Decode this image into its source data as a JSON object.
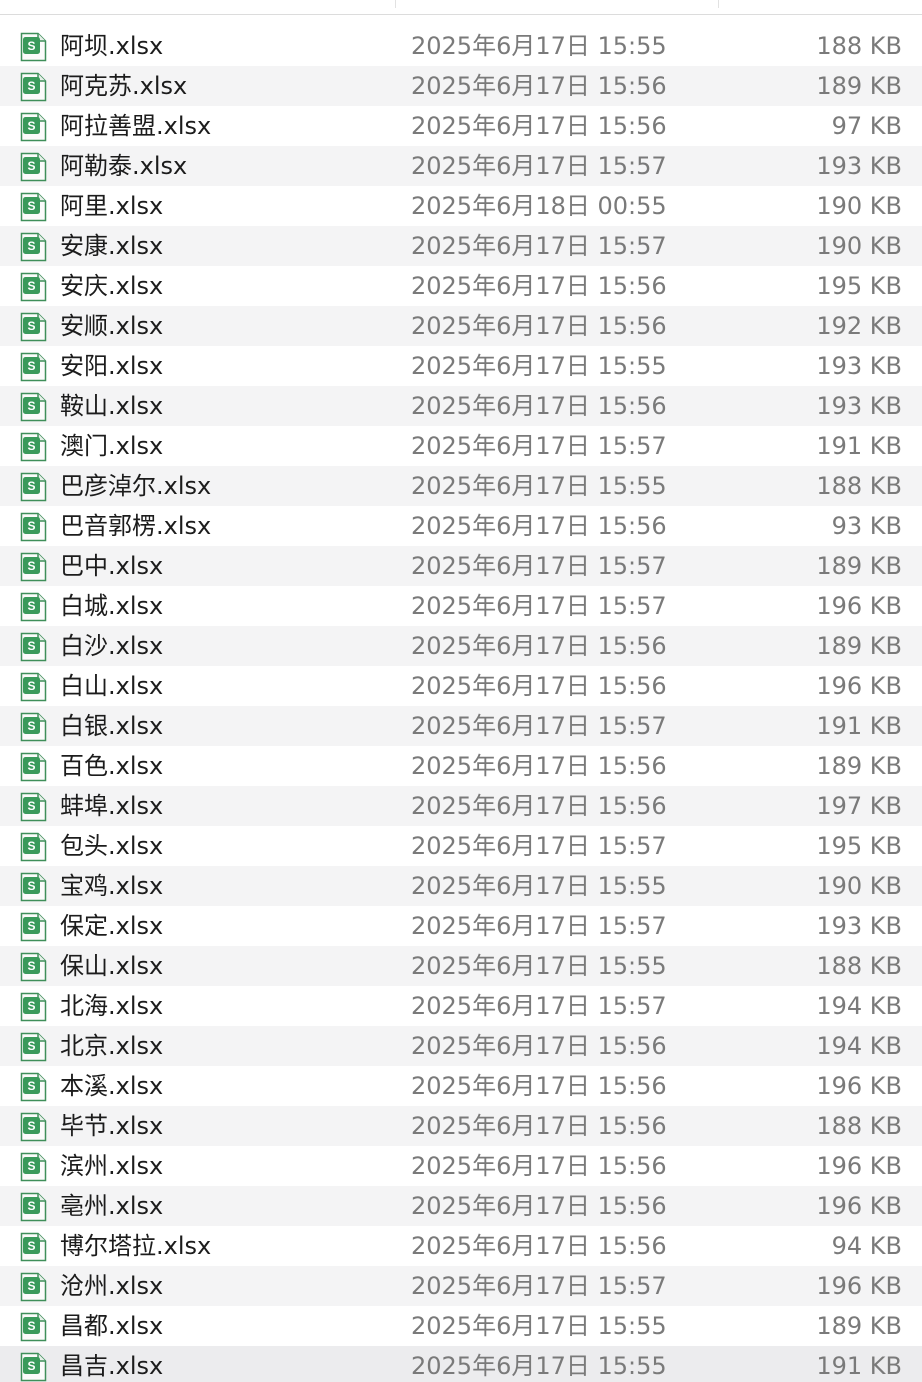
{
  "icon": "spreadsheet-file-icon",
  "icon_badge": "S",
  "colors": {
    "icon_green": "#3a9a5b",
    "icon_border": "#3f8f5a",
    "stripe": "#f4f4f5",
    "name_text": "#1c1c1c",
    "meta_text": "#7a7a7a"
  },
  "files": [
    {
      "name": "阿坝.xlsx",
      "date": "2025年6月17日 15:55",
      "size": "188 KB"
    },
    {
      "name": "阿克苏.xlsx",
      "date": "2025年6月17日 15:56",
      "size": "189 KB"
    },
    {
      "name": "阿拉善盟.xlsx",
      "date": "2025年6月17日 15:56",
      "size": "97 KB"
    },
    {
      "name": "阿勒泰.xlsx",
      "date": "2025年6月17日 15:57",
      "size": "193 KB"
    },
    {
      "name": "阿里.xlsx",
      "date": "2025年6月18日 00:55",
      "size": "190 KB"
    },
    {
      "name": "安康.xlsx",
      "date": "2025年6月17日 15:57",
      "size": "190 KB"
    },
    {
      "name": "安庆.xlsx",
      "date": "2025年6月17日 15:56",
      "size": "195 KB"
    },
    {
      "name": "安顺.xlsx",
      "date": "2025年6月17日 15:56",
      "size": "192 KB"
    },
    {
      "name": "安阳.xlsx",
      "date": "2025年6月17日 15:55",
      "size": "193 KB"
    },
    {
      "name": "鞍山.xlsx",
      "date": "2025年6月17日 15:56",
      "size": "193 KB"
    },
    {
      "name": "澳门.xlsx",
      "date": "2025年6月17日 15:57",
      "size": "191 KB"
    },
    {
      "name": "巴彦淖尔.xlsx",
      "date": "2025年6月17日 15:55",
      "size": "188 KB"
    },
    {
      "name": "巴音郭楞.xlsx",
      "date": "2025年6月17日 15:56",
      "size": "93 KB"
    },
    {
      "name": "巴中.xlsx",
      "date": "2025年6月17日 15:57",
      "size": "189 KB"
    },
    {
      "name": "白城.xlsx",
      "date": "2025年6月17日 15:57",
      "size": "196 KB"
    },
    {
      "name": "白沙.xlsx",
      "date": "2025年6月17日 15:56",
      "size": "189 KB"
    },
    {
      "name": "白山.xlsx",
      "date": "2025年6月17日 15:56",
      "size": "196 KB"
    },
    {
      "name": "白银.xlsx",
      "date": "2025年6月17日 15:57",
      "size": "191 KB"
    },
    {
      "name": "百色.xlsx",
      "date": "2025年6月17日 15:56",
      "size": "189 KB"
    },
    {
      "name": "蚌埠.xlsx",
      "date": "2025年6月17日 15:56",
      "size": "197 KB"
    },
    {
      "name": "包头.xlsx",
      "date": "2025年6月17日 15:57",
      "size": "195 KB"
    },
    {
      "name": "宝鸡.xlsx",
      "date": "2025年6月17日 15:55",
      "size": "190 KB"
    },
    {
      "name": "保定.xlsx",
      "date": "2025年6月17日 15:57",
      "size": "193 KB"
    },
    {
      "name": "保山.xlsx",
      "date": "2025年6月17日 15:55",
      "size": "188 KB"
    },
    {
      "name": "北海.xlsx",
      "date": "2025年6月17日 15:57",
      "size": "194 KB"
    },
    {
      "name": "北京.xlsx",
      "date": "2025年6月17日 15:56",
      "size": "194 KB"
    },
    {
      "name": "本溪.xlsx",
      "date": "2025年6月17日 15:56",
      "size": "196 KB"
    },
    {
      "name": "毕节.xlsx",
      "date": "2025年6月17日 15:56",
      "size": "188 KB"
    },
    {
      "name": "滨州.xlsx",
      "date": "2025年6月17日 15:56",
      "size": "196 KB"
    },
    {
      "name": "亳州.xlsx",
      "date": "2025年6月17日 15:56",
      "size": "196 KB"
    },
    {
      "name": "博尔塔拉.xlsx",
      "date": "2025年6月17日 15:56",
      "size": "94 KB"
    },
    {
      "name": "沧州.xlsx",
      "date": "2025年6月17日 15:57",
      "size": "196 KB"
    },
    {
      "name": "昌都.xlsx",
      "date": "2025年6月17日 15:55",
      "size": "189 KB"
    },
    {
      "name": "昌吉.xlsx",
      "date": "2025年6月17日 15:55",
      "size": "191 KB"
    }
  ]
}
